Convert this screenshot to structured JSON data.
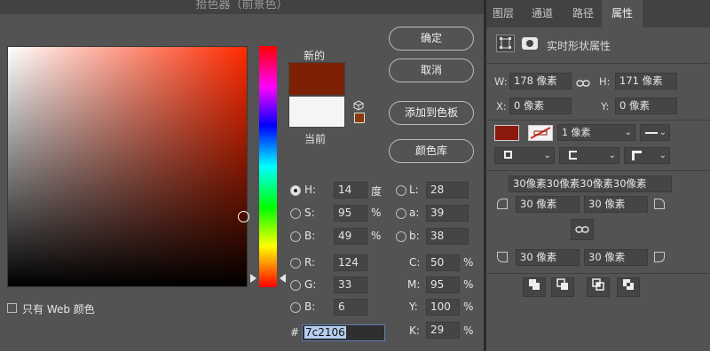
{
  "dialog": {
    "title": "拾色器（前景色）",
    "new_label": "新的",
    "current_label": "当前",
    "new_color": "#7c2106",
    "current_color": "#f5f5f5",
    "buttons": {
      "ok": "确定",
      "cancel": "取消",
      "add_swatch": "添加到色板",
      "color_libraries": "颜色库"
    },
    "web_only_label": "只有 Web 颜色",
    "hsb": {
      "h_label": "H:",
      "h_value": "14",
      "h_unit": "度",
      "s_label": "S:",
      "s_value": "95",
      "s_unit": "%",
      "b_label": "B:",
      "b_value": "49",
      "b_unit": "%"
    },
    "lab": {
      "l_label": "L:",
      "l_value": "28",
      "a_label": "a:",
      "a_value": "39",
      "b_label": "b:",
      "b_value": "38"
    },
    "rgb": {
      "r_label": "R:",
      "r_value": "124",
      "g_label": "G:",
      "g_value": "33",
      "b_label": "B:",
      "b_value": "6"
    },
    "cmyk": {
      "c_label": "C:",
      "c_value": "50",
      "m_label": "M:",
      "m_value": "95",
      "y_label": "Y:",
      "y_value": "100",
      "k_label": "K:",
      "k_value": "29",
      "unit": "%"
    },
    "hex_label": "#",
    "hex_value": "7c2106"
  },
  "panel": {
    "tabs": [
      "图层",
      "通道",
      "路径",
      "属性"
    ],
    "active_tab": "属性",
    "section_title": "实时形状属性",
    "w_label": "W:",
    "w_value": "178 像素",
    "h_label": "H:",
    "h_value": "171 像素",
    "x_label": "X:",
    "x_value": "0 像素",
    "y_label": "Y:",
    "y_value": "0 像素",
    "fill_color": "#8b1a0c",
    "stroke_width": "1 像素",
    "corner_radii_all": "30像素30像素30像素30像素",
    "corner_tl": "30 像素",
    "corner_tr": "30 像素",
    "corner_bl": "30 像素",
    "corner_br": "30 像素"
  },
  "icons": {
    "link": "link-icon",
    "cube": "websafe-cube-icon",
    "gamut": "gamut-warning-icon"
  }
}
